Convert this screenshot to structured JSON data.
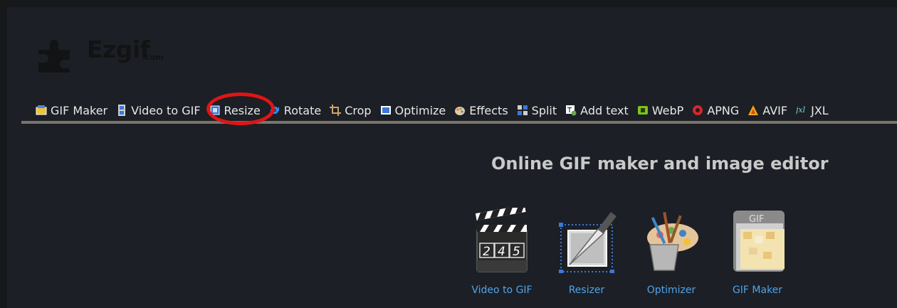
{
  "logo": {
    "text": "Ezgif",
    "suffix": ".com"
  },
  "nav": [
    {
      "label": "GIF Maker",
      "icon": "gif-maker-icon"
    },
    {
      "label": "Video to GIF",
      "icon": "film-icon"
    },
    {
      "label": "Resize",
      "icon": "resize-icon"
    },
    {
      "label": "Rotate",
      "icon": "rotate-icon"
    },
    {
      "label": "Crop",
      "icon": "crop-icon"
    },
    {
      "label": "Optimize",
      "icon": "optimize-icon"
    },
    {
      "label": "Effects",
      "icon": "palette-icon"
    },
    {
      "label": "Split",
      "icon": "split-icon"
    },
    {
      "label": "Add text",
      "icon": "add-text-icon"
    },
    {
      "label": "WebP",
      "icon": "webp-icon"
    },
    {
      "label": "APNG",
      "icon": "apng-icon"
    },
    {
      "label": "AVIF",
      "icon": "avif-icon"
    },
    {
      "label": "JXL",
      "icon": "jxl-icon"
    }
  ],
  "headline": "Online GIF maker and image editor",
  "tools": [
    {
      "label": "Video to GIF",
      "icon": "clapperboard-icon",
      "digits": [
        "2",
        "4",
        "5"
      ]
    },
    {
      "label": "Resizer",
      "icon": "resizer-icon"
    },
    {
      "label": "Optimizer",
      "icon": "paint-bucket-icon"
    },
    {
      "label": "GIF Maker",
      "icon": "gif-file-icon",
      "badge": "GIF"
    }
  ],
  "colors": {
    "background": "#1c1f25",
    "nav_text": "#e8e8e8",
    "nav_border": "#7b7469",
    "link": "#4ea4ec",
    "highlight_circle": "#e01515"
  }
}
